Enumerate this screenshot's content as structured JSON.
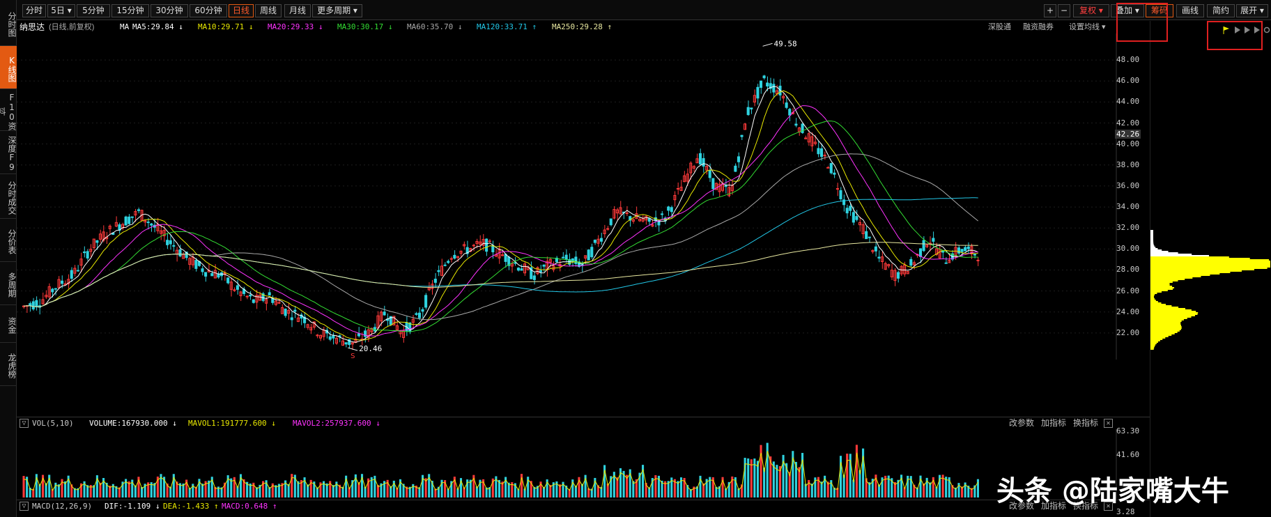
{
  "sidebar": {
    "items": [
      {
        "label": "分时图",
        "active": false
      },
      {
        "label": "K线图",
        "active": true
      },
      {
        "label": "F10资料",
        "active": false
      },
      {
        "label": "深度F9",
        "active": false
      },
      {
        "label": "分时成交",
        "active": false
      },
      {
        "label": "分价表",
        "active": false
      },
      {
        "label": "多周期",
        "active": false
      },
      {
        "label": "资金",
        "active": false
      },
      {
        "label": "龙虎榜",
        "active": false
      }
    ]
  },
  "toolbar": {
    "periods": [
      "分时",
      "5日 ▾",
      "5分钟",
      "15分钟",
      "30分钟",
      "60分钟",
      "日线",
      "周线",
      "月线",
      "更多周期 ▾"
    ],
    "active_period": "日线",
    "plus": "+",
    "minus": "−",
    "fuquan": "复权 ▾",
    "overlay": "叠加 ▾",
    "chips": "筹码",
    "draw": "画线",
    "jianyue": "简约",
    "expand": "展开 ▾"
  },
  "info": {
    "name": "纳思达",
    "mode": "(日线,前复权)",
    "ma_label": "MA",
    "ma5": "MA5:29.84 ↓",
    "ma10": "MA10:29.71 ↓",
    "ma20": "MA20:29.33 ↓",
    "ma30": "MA30:30.17 ↓",
    "ma60": "MA60:35.70 ↓",
    "ma120": "MA120:33.71 ↑",
    "ma250": "MA250:29.28 ↑",
    "shengutong": "深股通",
    "rongzi": "融资融券",
    "settings": "设置均线 ▾"
  },
  "colors": {
    "up": "#ff3a3a",
    "down": "#2fd3e0",
    "ma5": "#ffffff",
    "ma10": "#e8e800",
    "ma20": "#ff33ff",
    "ma30": "#33dd33",
    "ma60": "#aaaaaa",
    "ma120": "#22c8e8",
    "ma250": "#e8e8a0",
    "accent": "#e35a12"
  },
  "price_axis": {
    "labels": [
      "48.00",
      "46.00",
      "44.00",
      "42.00",
      "40.00",
      "38.00",
      "36.00",
      "34.00",
      "32.00",
      "30.00",
      "28.00",
      "26.00",
      "24.00",
      "22.00"
    ],
    "current": "42.26"
  },
  "annotations": {
    "high": "49.58",
    "low": "20.46",
    "marker": "S"
  },
  "volume": {
    "title": "VOL(5,10)",
    "volume": "VOLUME:167930.000 ↓",
    "mavol1": "MAVOL1:191777.600 ↓",
    "mavol2": "MAVOL2:257937.600 ↓",
    "axis": [
      "63.30",
      "41.60"
    ],
    "change_params": "改参数",
    "add_indicator": "加指标",
    "switch_indicator": "换指标",
    "close": "✕"
  },
  "macd": {
    "title": "MACD(12,26,9)",
    "dif": "DIF:-1.109 ↓",
    "dea": "DEA:-1.433 ↑",
    "macd": "MACD:0.648 ↑",
    "axis": "3.28",
    "change_params": "改参数",
    "add_indicator": "加指标",
    "switch_indicator": "换指标",
    "close": "✕"
  },
  "watermark": "头条 @陆家嘴大牛",
  "chart_data": {
    "type": "candlestick",
    "series_names": [
      "MA5",
      "MA10",
      "MA20",
      "MA30",
      "MA60",
      "MA120",
      "MA250"
    ],
    "ylim": [
      20,
      50
    ],
    "high": 49.58,
    "low": 20.46,
    "close_shape": [
      24.5,
      25,
      26.5,
      27.5,
      30,
      31.5,
      32.5,
      33.5,
      32,
      30.5,
      29,
      28,
      27.5,
      26,
      25,
      25.5,
      24,
      23.5,
      22,
      21.5,
      21,
      22,
      24,
      22,
      23.5,
      27,
      29.5,
      30,
      30.5,
      29.5,
      28.5,
      27.5,
      28.5,
      29,
      28.5,
      31,
      33.5,
      33,
      32.5,
      33,
      36,
      39,
      36,
      35.5,
      43,
      46,
      45,
      42,
      40,
      38,
      34,
      32,
      29,
      27.5,
      28.5,
      31,
      29,
      30,
      29.5
    ]
  }
}
